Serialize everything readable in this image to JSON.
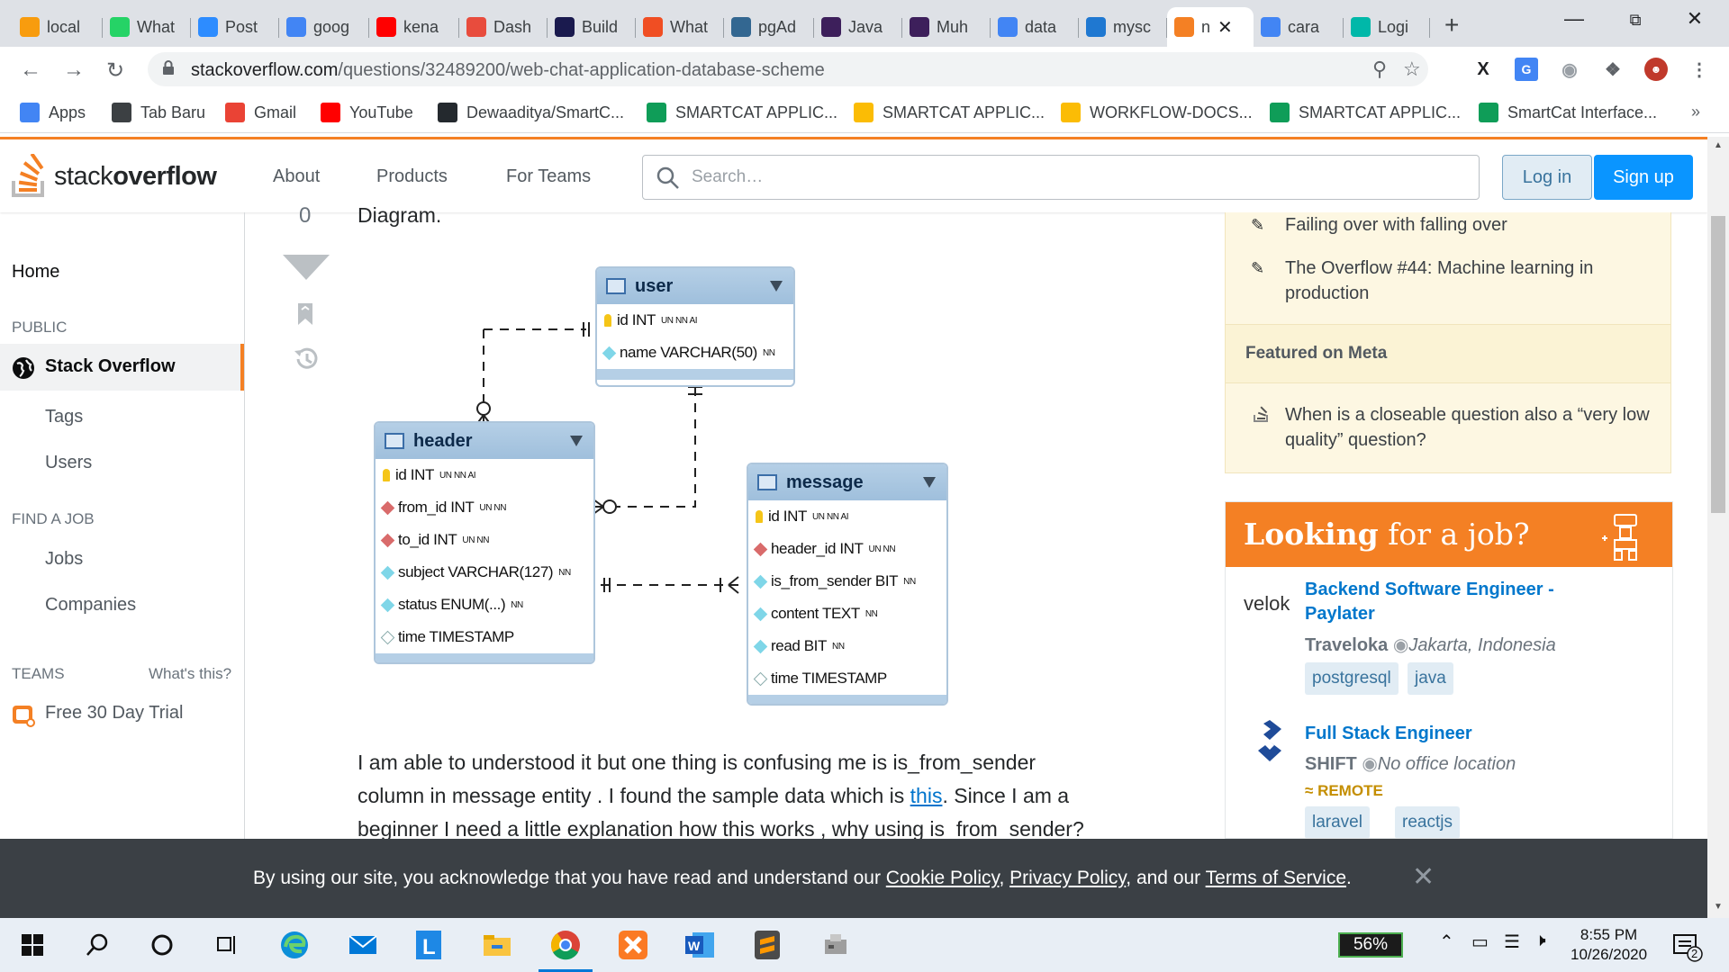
{
  "browser": {
    "tabs": [
      {
        "title": "local",
        "icon": "phpmyadmin-icon",
        "color": "#f89c0e"
      },
      {
        "title": "What",
        "icon": "whatsapp-icon",
        "color": "#25d366"
      },
      {
        "title": "Post",
        "icon": "zoom-icon",
        "color": "#2d8cff"
      },
      {
        "title": "goog",
        "icon": "google-icon",
        "color": "#4285f4"
      },
      {
        "title": "kena",
        "icon": "youtube-icon",
        "color": "#ff0000"
      },
      {
        "title": "Dash",
        "icon": "dash-icon",
        "color": "#e84c3d"
      },
      {
        "title": "Build",
        "icon": "build-icon",
        "color": "#1a1a4e"
      },
      {
        "title": "What",
        "icon": "fire-icon",
        "color": "#f04e23"
      },
      {
        "title": "pgAd",
        "icon": "pg-icon",
        "color": "#336791"
      },
      {
        "title": "Java",
        "icon": "p-icon",
        "color": "#3d1f5b"
      },
      {
        "title": "Muh",
        "icon": "p-icon",
        "color": "#3d1f5b"
      },
      {
        "title": "data",
        "icon": "google-icon",
        "color": "#4285f4"
      },
      {
        "title": "mysc",
        "icon": "drop-icon",
        "color": "#1f78d1"
      },
      {
        "title": "n",
        "icon": "stackoverflow-icon",
        "color": "#f48024",
        "active": true
      },
      {
        "title": "cara",
        "icon": "google-icon",
        "color": "#4285f4"
      },
      {
        "title": "Logi",
        "icon": "logi-icon",
        "color": "#00b8a9"
      }
    ],
    "url_domain": "stackoverflow.com",
    "url_path": "/questions/32489200/web-chat-application-database-scheme"
  },
  "bookmarks": [
    {
      "label": "Apps",
      "icon": "apps-grid-icon",
      "color": "#4285f4"
    },
    {
      "label": "Tab Baru",
      "icon": "globe-icon",
      "color": "#3c4043"
    },
    {
      "label": "Gmail",
      "icon": "gmail-icon",
      "color": "#ea4335"
    },
    {
      "label": "YouTube",
      "icon": "youtube-icon",
      "color": "#ff0000"
    },
    {
      "label": "Dewaaditya/SmartC...",
      "icon": "github-icon",
      "color": "#24292e"
    },
    {
      "label": "SMARTCAT APPLIC...",
      "icon": "sheets-icon",
      "color": "#0f9d58"
    },
    {
      "label": "SMARTCAT APPLIC...",
      "icon": "drive-icon",
      "color": "#fbbc05"
    },
    {
      "label": "WORKFLOW-DOCS...",
      "icon": "drive-icon",
      "color": "#fbbc05"
    },
    {
      "label": "SMARTCAT APPLIC...",
      "icon": "sheets-icon",
      "color": "#0f9d58"
    },
    {
      "label": "SmartCat Interface...",
      "icon": "sheets-icon",
      "color": "#0f9d58"
    }
  ],
  "so": {
    "logo_light": "stack",
    "logo_bold": "overflow",
    "nav": [
      "About",
      "Products",
      "For Teams"
    ],
    "search_placeholder": "Search…",
    "login": "Log in",
    "signup": "Sign up",
    "accent": "#f48024"
  },
  "leftnav": {
    "home": "Home",
    "public": "PUBLIC",
    "stackoverflow": "Stack Overflow",
    "tags": "Tags",
    "users": "Users",
    "find_job": "FIND A JOB",
    "jobs": "Jobs",
    "companies": "Companies",
    "teams": "TEAMS",
    "whats_this": "What's this?",
    "trial": "Free 30 Day Trial"
  },
  "vote_count": "0",
  "post": {
    "caption": "Diagram.",
    "paragraph_lines": [
      "I am able to understood it but one thing is confusing me is is_from_sender",
      "column in message entity . I found the sample data which is ",
      "beginner I need a little explanation how this works , why using is_from_sender?"
    ],
    "link_text": "this",
    "line2_after": ". Since I am a"
  },
  "erd": {
    "user": {
      "name": "user",
      "columns": [
        {
          "key": "pk",
          "text": "id INT",
          "flags": "UN NN AI"
        },
        {
          "key": "col",
          "text": "name VARCHAR(50)",
          "flags": "NN"
        }
      ]
    },
    "header": {
      "name": "header",
      "columns": [
        {
          "key": "pk",
          "text": "id INT",
          "flags": "UN NN AI"
        },
        {
          "key": "fk",
          "text": "from_id INT",
          "flags": "UN NN"
        },
        {
          "key": "fk",
          "text": "to_id INT",
          "flags": "UN NN"
        },
        {
          "key": "col",
          "text": "subject VARCHAR(127)",
          "flags": "NN"
        },
        {
          "key": "col",
          "text": "status ENUM(...)",
          "flags": "NN"
        },
        {
          "key": "null",
          "text": "time TIMESTAMP",
          "flags": ""
        }
      ]
    },
    "message": {
      "name": "message",
      "columns": [
        {
          "key": "pk",
          "text": "id INT",
          "flags": "UN NN AI"
        },
        {
          "key": "fk",
          "text": "header_id INT",
          "flags": "UN NN"
        },
        {
          "key": "col",
          "text": "is_from_sender BIT",
          "flags": "NN"
        },
        {
          "key": "col",
          "text": "content TEXT",
          "flags": "NN"
        },
        {
          "key": "col",
          "text": "read BIT",
          "flags": "NN"
        },
        {
          "key": "null",
          "text": "time TIMESTAMP",
          "flags": ""
        }
      ]
    }
  },
  "sidebar": {
    "blog_items": [
      "Failing over with falling over",
      "The Overflow #44: Machine learning in production"
    ],
    "featured_meta": "Featured on Meta",
    "meta_item": "When is a closeable question also a “very low quality” question?",
    "jobs_title_bold": "Looking",
    "jobs_title_rest": " for a job?",
    "jobs": [
      {
        "logo": "velok",
        "title": "Backend Software Engineer - Paylater",
        "company": "Traveloka",
        "location": "Jakarta, Indonesia",
        "tags": [
          "postgresql",
          "java"
        ]
      },
      {
        "logo": "shift-logo-icon",
        "title": "Full Stack Engineer",
        "company": "SHIFT",
        "location": "No office location",
        "remote": "REMOTE",
        "tags": [
          "laravel",
          "reactjs"
        ]
      }
    ]
  },
  "cookie": {
    "prefix": "By using our site, you acknowledge that you have read and understand our ",
    "cookie_policy": "Cookie Policy",
    "comma": ", ",
    "privacy_policy": "Privacy Policy",
    "and_our": ", and our ",
    "terms": "Terms of Service",
    "period": "."
  },
  "taskbar": {
    "battery": "56%",
    "time": "8:55 PM",
    "date": "10/26/2020",
    "notifications": "2"
  }
}
